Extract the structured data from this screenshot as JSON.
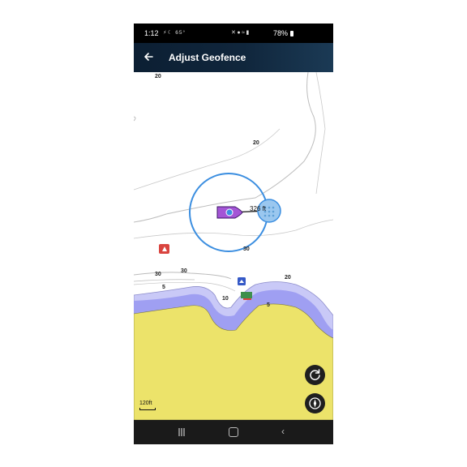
{
  "status_bar": {
    "time": "1:12",
    "temperature": "65°",
    "battery": "78%"
  },
  "app_bar": {
    "title": "Adjust Geofence"
  },
  "map": {
    "depth_labels": [
      "20",
      "20",
      "30",
      "30",
      "30",
      "5",
      "10",
      "5",
      "20"
    ],
    "geofence_distance": "326 ft",
    "scale": "120ft"
  },
  "colors": {
    "land": "#ece36a",
    "shallow_water": "#9f9ff2",
    "deep_shallow": "#c9c9f7",
    "geofence": "#3b8ee0",
    "boat": "#a455d6"
  }
}
